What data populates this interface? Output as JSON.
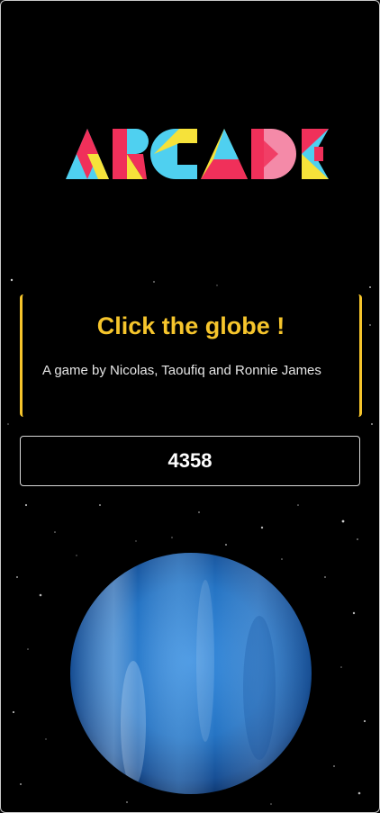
{
  "logo": {
    "text": "ARCADE"
  },
  "header": {
    "title": "Click the globe !",
    "credits": "A game by Nicolas, Taoufiq and Ronnie James"
  },
  "score": {
    "value": "4358"
  },
  "globe": {
    "icon": "planet-globe-icon"
  },
  "colors": {
    "accent": "#f6c52c",
    "logo_blue": "#4fd0f0",
    "logo_red": "#f0305a",
    "logo_yellow": "#f6e23a",
    "logo_pink": "#f48aa8",
    "globe_blue": "#2e7fd0",
    "background": "#000000"
  }
}
